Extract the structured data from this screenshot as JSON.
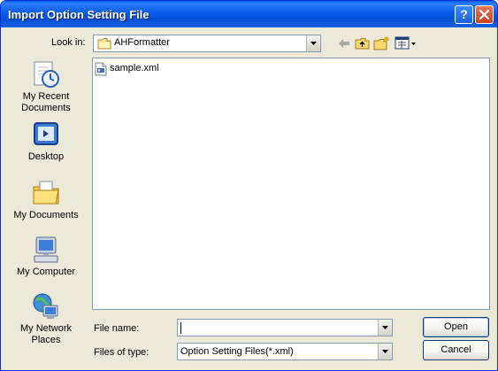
{
  "window": {
    "title": "Import Option Setting File",
    "help_glyph": "?",
    "close_icon": "close-icon"
  },
  "toolbar": {
    "look_in_label": "Look in:",
    "look_in_accesskey": "i",
    "look_in_value": "AHFormatter",
    "icons": [
      "back-arrow-icon",
      "up-folder-icon",
      "new-folder-icon",
      "views-menu-icon"
    ]
  },
  "places": [
    {
      "label": "My Recent Documents",
      "icon": "recent-documents-icon"
    },
    {
      "label": "Desktop",
      "icon": "desktop-icon"
    },
    {
      "label": "My Documents",
      "icon": "my-documents-icon"
    },
    {
      "label": "My Computer",
      "icon": "my-computer-icon"
    },
    {
      "label": "My Network Places",
      "icon": "network-places-icon"
    }
  ],
  "files": [
    {
      "name": "sample.xml",
      "icon": "xml-file-icon"
    }
  ],
  "form": {
    "file_name_label": "File name:",
    "file_name_value": "",
    "files_of_type_label": "Files of type:",
    "files_of_type_value": "Option Setting Files(*.xml)"
  },
  "buttons": {
    "open": "Open",
    "cancel": "Cancel"
  },
  "colors": {
    "titlebar": "#0054e3",
    "dialog_bg": "#ece9d8",
    "field_border": "#7f9db9"
  }
}
